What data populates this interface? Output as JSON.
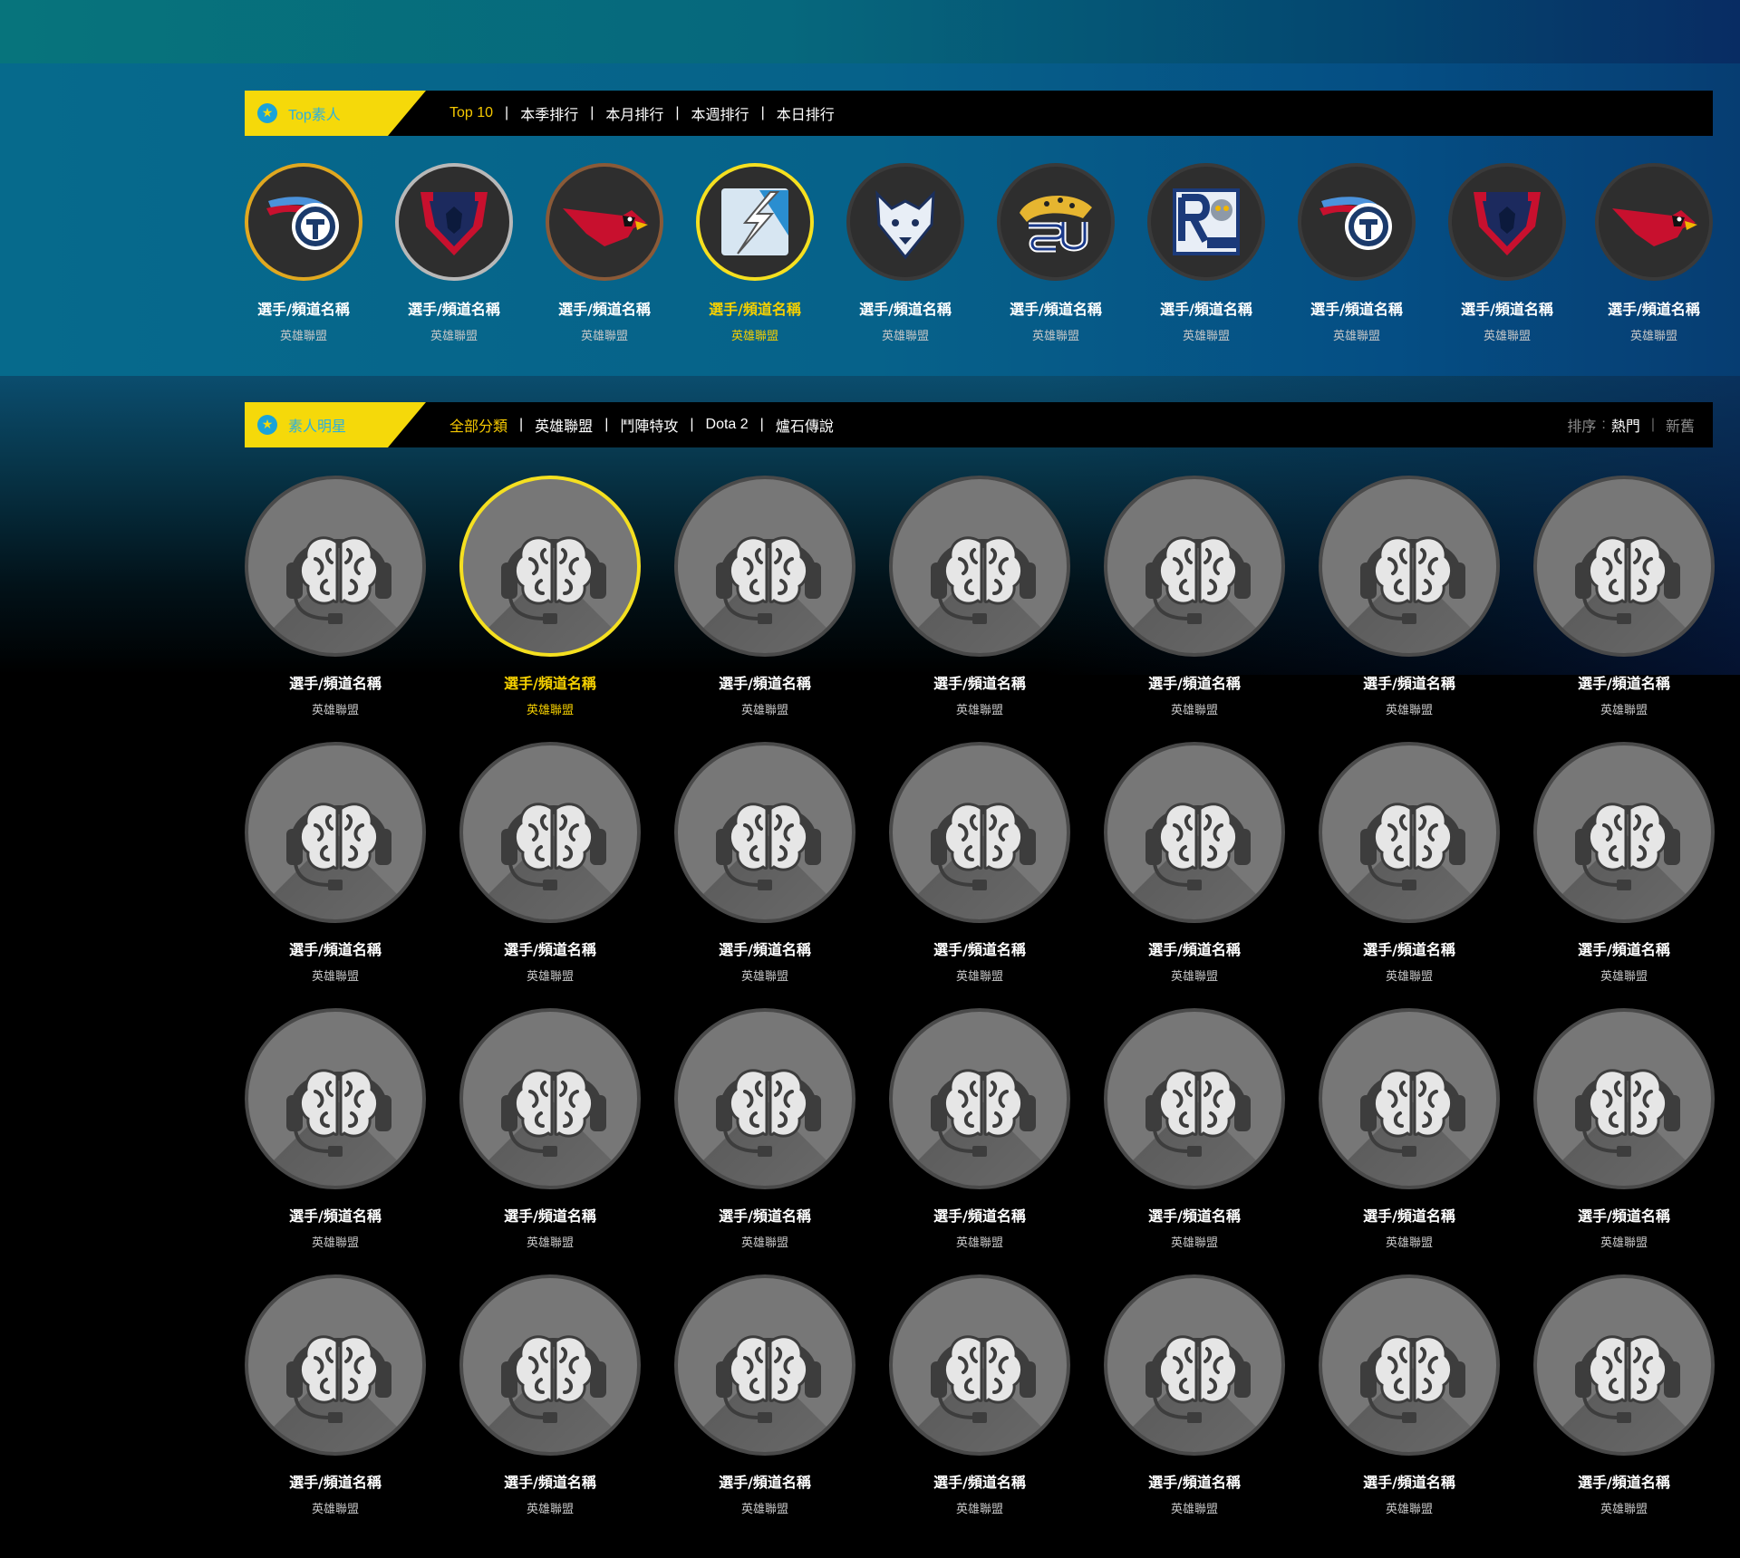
{
  "top_section": {
    "tag_label": "Top素人",
    "tabs": [
      "Top 10",
      "本季排行",
      "本月排行",
      "本週排行",
      "本日排行"
    ],
    "items": [
      {
        "name": "選手/頻道名稱",
        "game": "英雄聯盟",
        "icon": "titans-logo-icon"
      },
      {
        "name": "選手/頻道名稱",
        "game": "英雄聯盟",
        "icon": "depaul-logo-icon"
      },
      {
        "name": "選手/頻道名稱",
        "game": "英雄聯盟",
        "icon": "cardinal-logo-icon"
      },
      {
        "name": "選手/頻道名稱",
        "game": "英雄聯盟",
        "icon": "lightning-logo-icon"
      },
      {
        "name": "選手/頻道名稱",
        "game": "英雄聯盟",
        "icon": "husky-logo-icon"
      },
      {
        "name": "選手/頻道名稱",
        "game": "英雄聯盟",
        "icon": "jaguar-su-logo-icon"
      },
      {
        "name": "選手/頻道名稱",
        "game": "英雄聯盟",
        "icon": "rice-owls-logo-icon"
      },
      {
        "name": "選手/頻道名稱",
        "game": "英雄聯盟",
        "icon": "titans-logo-icon"
      },
      {
        "name": "選手/頻道名稱",
        "game": "英雄聯盟",
        "icon": "depaul-logo-icon"
      },
      {
        "name": "選手/頻道名稱",
        "game": "英雄聯盟",
        "icon": "cardinal-logo-icon"
      }
    ]
  },
  "stars_section": {
    "tag_label": "素人明星",
    "tabs": [
      "全部分類",
      "英雄聯盟",
      "鬥陣特攻",
      "Dota 2",
      "爐石傳說"
    ],
    "sort_label": "排序",
    "sort_colon": ":",
    "sort_options": [
      "熱門",
      "新舊"
    ],
    "items": [
      {
        "name": "選手/頻道名稱",
        "game": "英雄聯盟"
      },
      {
        "name": "選手/頻道名稱",
        "game": "英雄聯盟"
      },
      {
        "name": "選手/頻道名稱",
        "game": "英雄聯盟"
      },
      {
        "name": "選手/頻道名稱",
        "game": "英雄聯盟"
      },
      {
        "name": "選手/頻道名稱",
        "game": "英雄聯盟"
      },
      {
        "name": "選手/頻道名稱",
        "game": "英雄聯盟"
      },
      {
        "name": "選手/頻道名稱",
        "game": "英雄聯盟"
      },
      {
        "name": "選手/頻道名稱",
        "game": "英雄聯盟"
      },
      {
        "name": "選手/頻道名稱",
        "game": "英雄聯盟"
      },
      {
        "name": "選手/頻道名稱",
        "game": "英雄聯盟"
      },
      {
        "name": "選手/頻道名稱",
        "game": "英雄聯盟"
      },
      {
        "name": "選手/頻道名稱",
        "game": "英雄聯盟"
      },
      {
        "name": "選手/頻道名稱",
        "game": "英雄聯盟"
      },
      {
        "name": "選手/頻道名稱",
        "game": "英雄聯盟"
      },
      {
        "name": "選手/頻道名稱",
        "game": "英雄聯盟"
      },
      {
        "name": "選手/頻道名稱",
        "game": "英雄聯盟"
      },
      {
        "name": "選手/頻道名稱",
        "game": "英雄聯盟"
      },
      {
        "name": "選手/頻道名稱",
        "game": "英雄聯盟"
      },
      {
        "name": "選手/頻道名稱",
        "game": "英雄聯盟"
      },
      {
        "name": "選手/頻道名稱",
        "game": "英雄聯盟"
      },
      {
        "name": "選手/頻道名稱",
        "game": "英雄聯盟"
      },
      {
        "name": "選手/頻道名稱",
        "game": "英雄聯盟"
      },
      {
        "name": "選手/頻道名稱",
        "game": "英雄聯盟"
      },
      {
        "name": "選手/頻道名稱",
        "game": "英雄聯盟"
      },
      {
        "name": "選手/頻道名稱",
        "game": "英雄聯盟"
      },
      {
        "name": "選手/頻道名稱",
        "game": "英雄聯盟"
      },
      {
        "name": "選手/頻道名稱",
        "game": "英雄聯盟"
      },
      {
        "name": "選手/頻道名稱",
        "game": "英雄聯盟"
      }
    ]
  },
  "colors": {
    "accent_yellow": "#f5d90a",
    "highlight_text": "#f5d000",
    "star_badge_blue": "#1aa3d9"
  }
}
